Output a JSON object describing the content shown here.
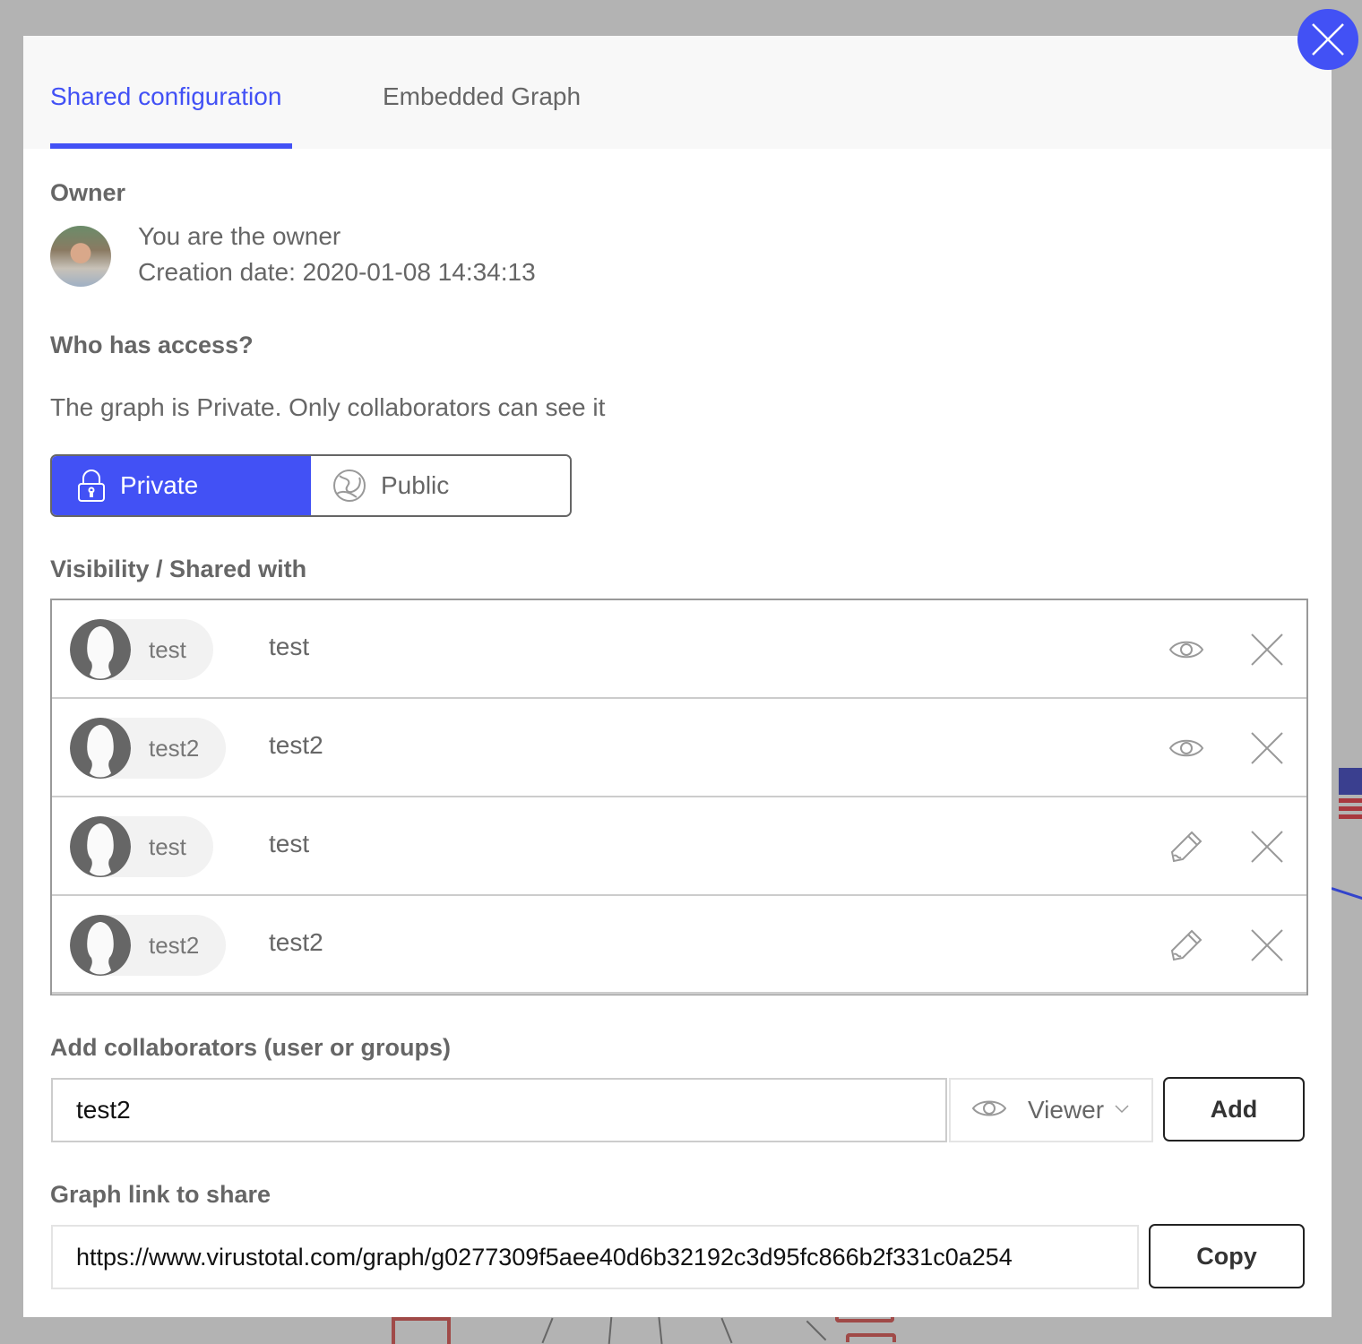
{
  "colors": {
    "accent": "#4251f5",
    "backdrop": "#b3b3b3",
    "text_muted": "#666666",
    "chip_bg": "#f2f2f2"
  },
  "tabs": [
    {
      "label": "Shared configuration",
      "active": true
    },
    {
      "label": "Embedded Graph",
      "active": false
    }
  ],
  "close_icon": "close-icon",
  "owner": {
    "title": "Owner",
    "line1": "You are the owner",
    "line2": "Creation date: 2020-01-08 14:34:13"
  },
  "access": {
    "title": "Who has access?",
    "description": "The graph is Private. Only collaborators can see it",
    "options": [
      {
        "label": "Private",
        "icon": "lock-icon",
        "selected": true
      },
      {
        "label": "Public",
        "icon": "globe-icon",
        "selected": false
      }
    ]
  },
  "shared_with": {
    "title": "Visibility / Shared with",
    "rows": [
      {
        "chip": "test",
        "name": "test",
        "permission": "viewer",
        "permission_icon": "eye-icon"
      },
      {
        "chip": "test2",
        "name": "test2",
        "permission": "viewer",
        "permission_icon": "eye-icon"
      },
      {
        "chip": "test",
        "name": "test",
        "permission": "editor",
        "permission_icon": "pencil-icon"
      },
      {
        "chip": "test2",
        "name": "test2",
        "permission": "editor",
        "permission_icon": "pencil-icon"
      }
    ]
  },
  "add_collaborators": {
    "title": "Add collaborators (user or groups)",
    "input_value": "test2",
    "role": "Viewer",
    "add_label": "Add"
  },
  "link": {
    "title": "Graph link to share",
    "value": "https://www.virustotal.com/graph/g0277309f5aee40d6b32192c3d95fc866b2f331c0a254",
    "copy_label": "Copy"
  }
}
